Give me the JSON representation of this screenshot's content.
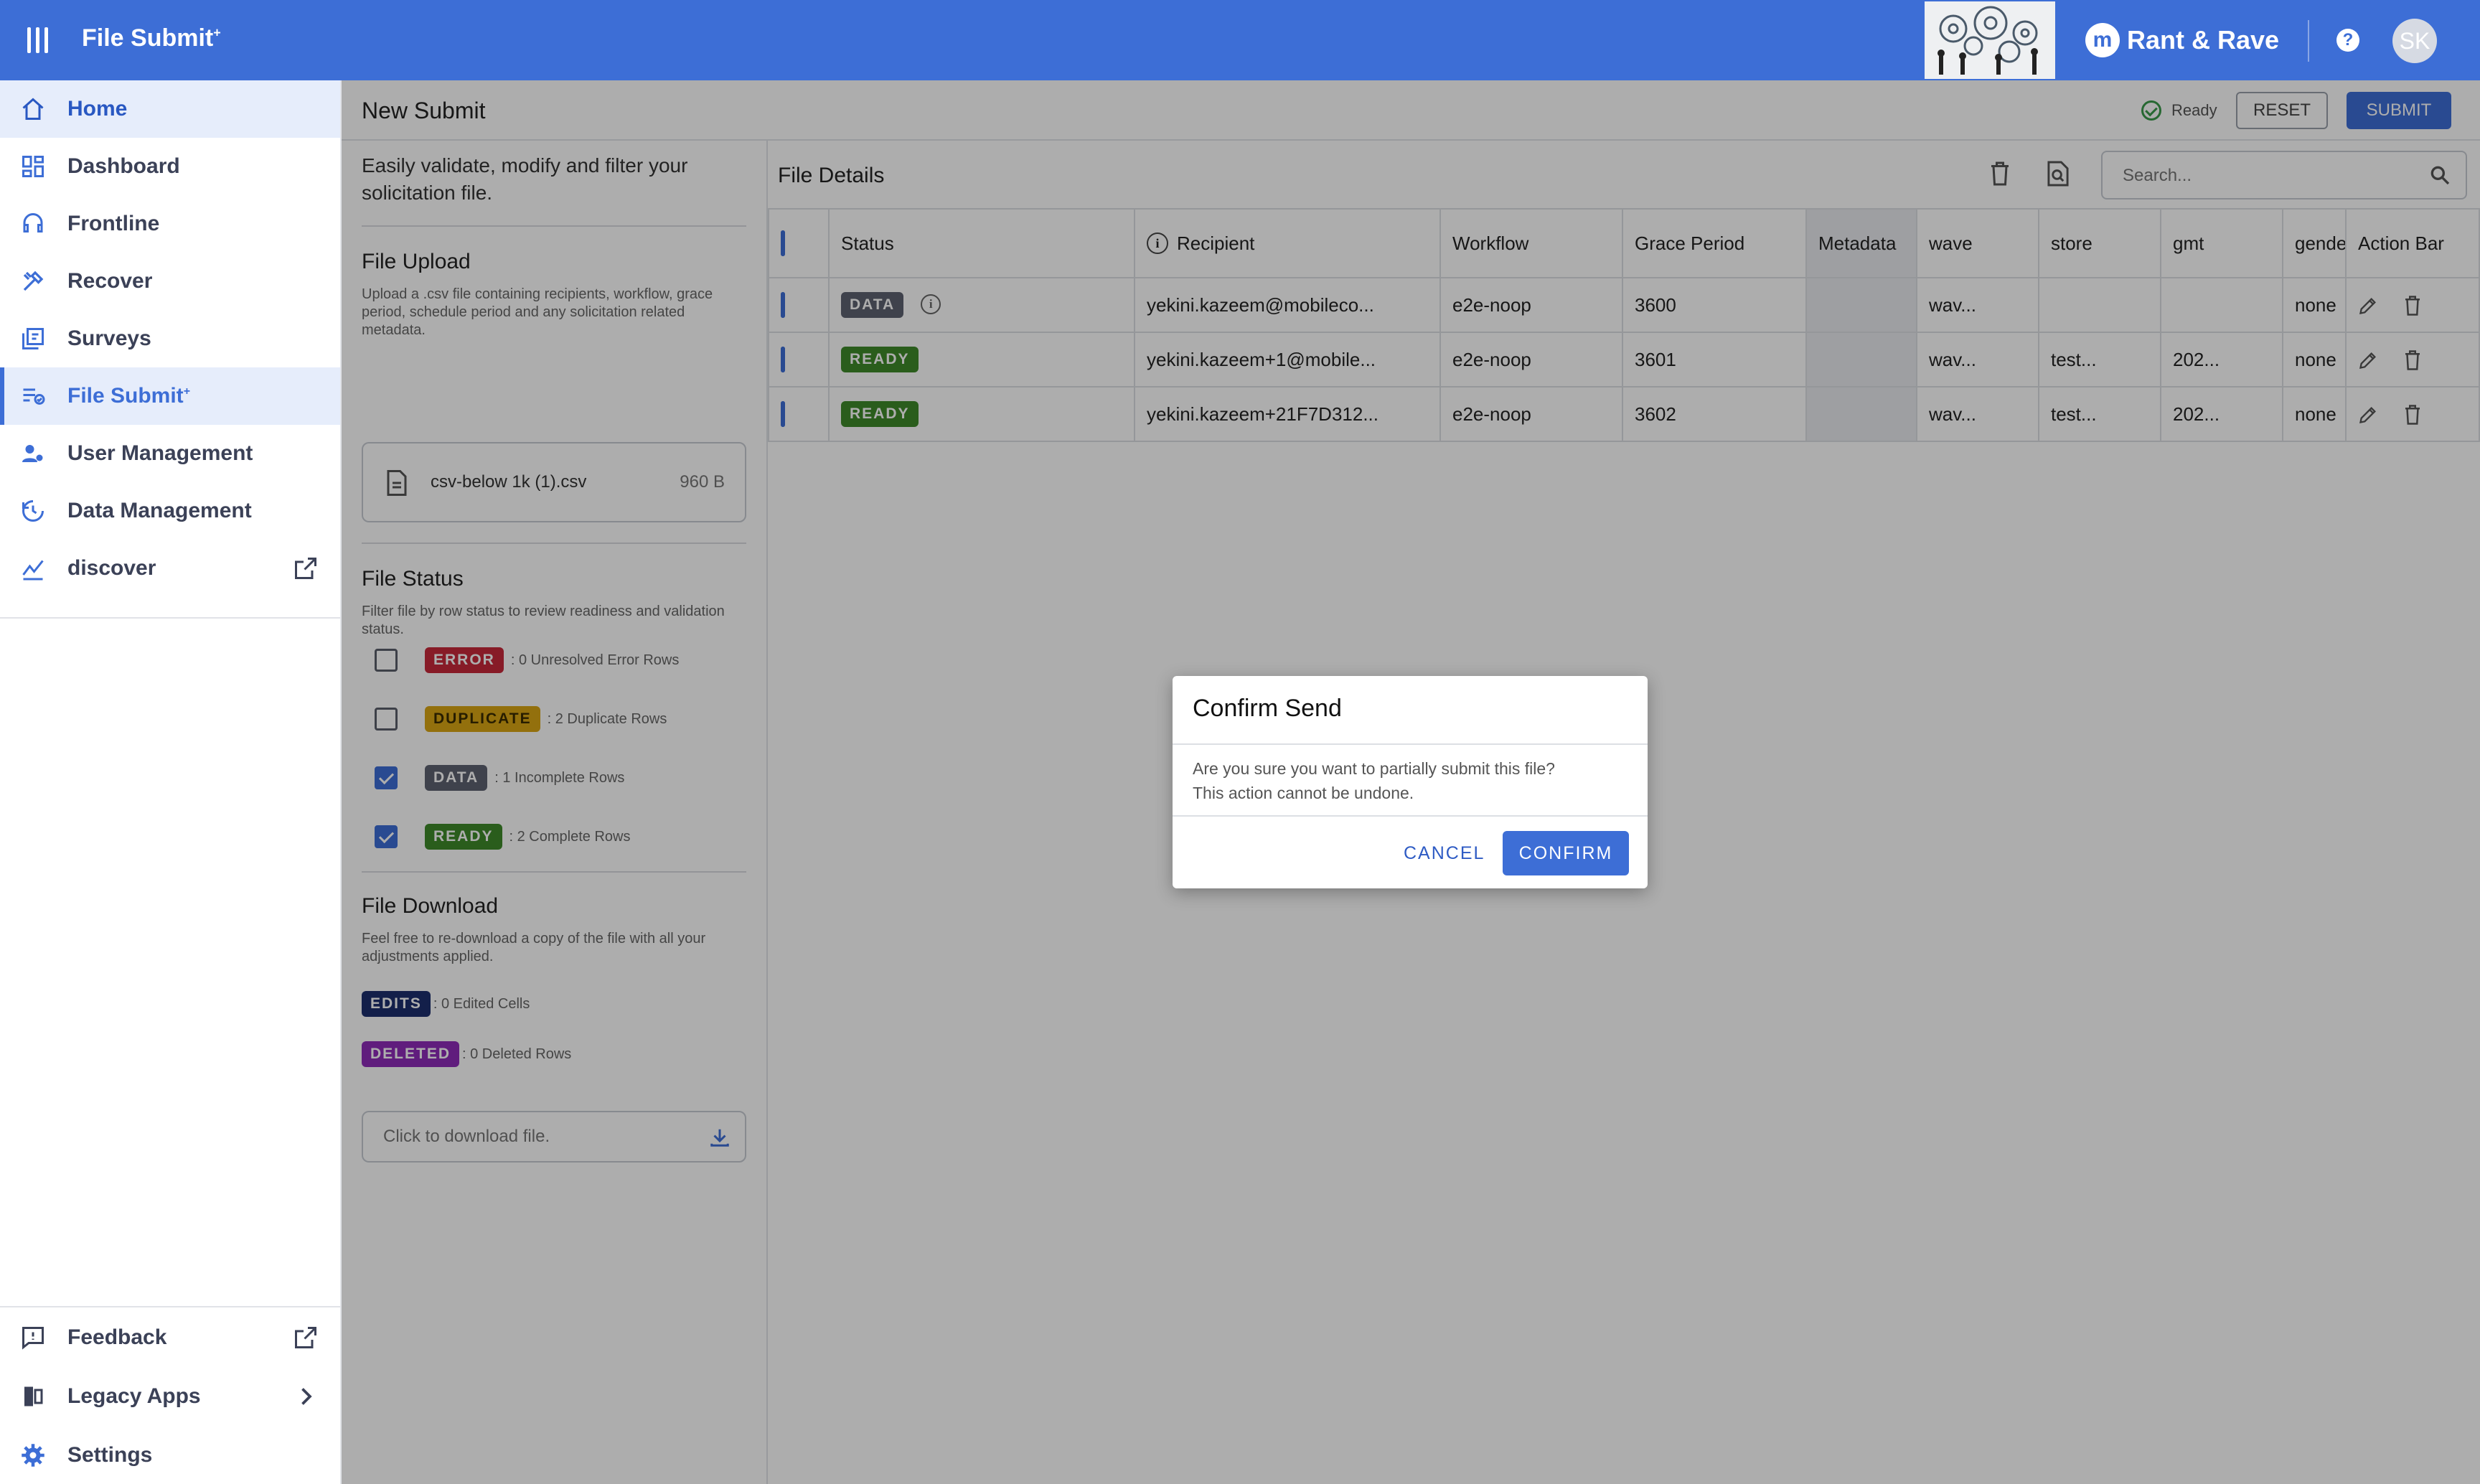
{
  "app": {
    "title": "File Submit",
    "title_sup": "+",
    "brand": "Rant & Rave",
    "brand_mark": "m",
    "help": "?",
    "avatar_initials": "SK"
  },
  "sidebar": {
    "items": [
      {
        "label": "Home",
        "icon": "home-icon"
      },
      {
        "label": "Dashboard",
        "icon": "dashboard-icon"
      },
      {
        "label": "Frontline",
        "icon": "headset-icon"
      },
      {
        "label": "Recover",
        "icon": "tools-icon"
      },
      {
        "label": "Surveys",
        "icon": "survey-icon"
      },
      {
        "label": "File Submit",
        "sup": "+",
        "icon": "file-submit-icon"
      },
      {
        "label": "User Management",
        "icon": "user-management-icon"
      },
      {
        "label": "Data Management",
        "icon": "data-management-icon"
      },
      {
        "label": "discover",
        "icon": "discover-icon"
      }
    ],
    "footer": [
      {
        "label": "Feedback",
        "icon": "feedback-icon"
      },
      {
        "label": "Legacy Apps",
        "icon": "legacy-apps-icon"
      },
      {
        "label": "Settings",
        "icon": "gear-icon"
      }
    ]
  },
  "header": {
    "title": "New Submit",
    "status": "Ready",
    "reset_label": "RESET",
    "submit_label": "SUBMIT"
  },
  "left_panel": {
    "intro": "Easily validate, modify and filter your solicitation file.",
    "upload": {
      "title": "File Upload",
      "desc": "Upload a .csv file containing recipients, workflow, grace period, schedule period and any solicitation related metadata.",
      "file_name": "csv-below 1k (1).csv",
      "file_size": "960 B"
    },
    "status": {
      "title": "File Status",
      "desc": "Filter file by row status to review readiness and validation status.",
      "filters": [
        {
          "badge": "ERROR",
          "text": ": 0 Unresolved Error Rows",
          "checked": false
        },
        {
          "badge": "DUPLICATE",
          "text": ": 2 Duplicate Rows",
          "checked": false
        },
        {
          "badge": "DATA",
          "text": ": 1 Incomplete Rows",
          "checked": true
        },
        {
          "badge": "READY",
          "text": ": 2 Complete Rows",
          "checked": true
        }
      ]
    },
    "download": {
      "title": "File Download",
      "desc": "Feel free to re-download a copy of the file with all your adjustments applied.",
      "edits_badge": "EDITS",
      "edits_text": ": 0 Edited Cells",
      "deleted_badge": "DELETED",
      "deleted_text": ": 0 Deleted Rows",
      "button_text": "Click to download file."
    }
  },
  "file_details": {
    "title": "File Details",
    "search_placeholder": "Search...",
    "columns": [
      "Status",
      "Recipient",
      "Workflow",
      "Grace Period",
      "Metadata",
      "wave",
      "store",
      "gmt",
      "gende",
      "Action Bar"
    ],
    "rows": [
      {
        "status": "DATA",
        "recipient": "yekini.kazeem@mobileco...",
        "workflow": "e2e-noop",
        "grace": "3600",
        "metadata": "",
        "wave": "wav...",
        "store": "",
        "gmt": "",
        "gender": "none"
      },
      {
        "status": "READY",
        "recipient": "yekini.kazeem+1@mobile...",
        "workflow": "e2e-noop",
        "grace": "3601",
        "metadata": "",
        "wave": "wav...",
        "store": "test...",
        "gmt": "202...",
        "gender": "none"
      },
      {
        "status": "READY",
        "recipient": "yekini.kazeem+21F7D312...",
        "workflow": "e2e-noop",
        "grace": "3602",
        "metadata": "",
        "wave": "wav...",
        "store": "test...",
        "gmt": "202...",
        "gender": "none"
      }
    ]
  },
  "dialog": {
    "title": "Confirm Send",
    "body_line1": "Are you sure you want to partially submit this file?",
    "body_line2": "This action cannot be undone.",
    "cancel_label": "CANCEL",
    "confirm_label": "CONFIRM"
  },
  "colors": {
    "primary": "#3d6ed6",
    "error": "#c8283a",
    "duplicate": "#d9a514",
    "data": "#5e6270",
    "ready": "#3f8a2a",
    "edits": "#1d2e6e",
    "deleted": "#8e2cb8"
  }
}
